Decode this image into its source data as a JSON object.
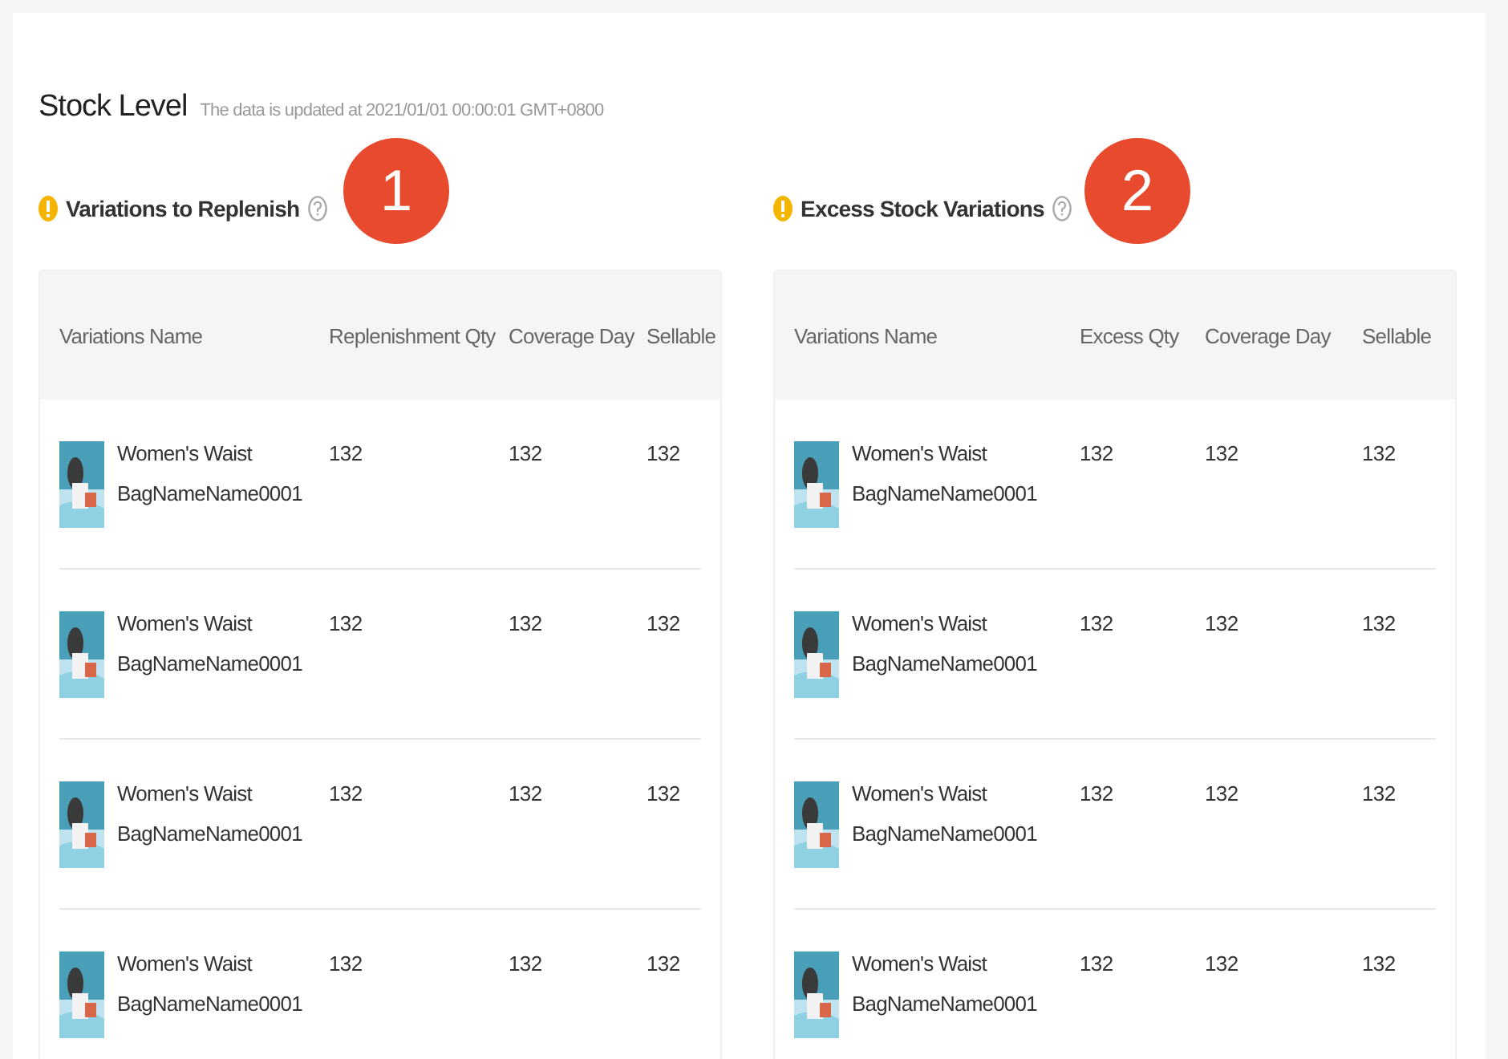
{
  "header": {
    "title": "Stock Level",
    "subtitle": "The data is updated at 2021/01/01 00:00:01 GMT+0800"
  },
  "sections": [
    {
      "marker": "1",
      "title": "Variations to Replenish",
      "columns": [
        "Variations Name",
        "Replenishment Qty",
        "Coverage Day",
        "Sellable"
      ],
      "rows": [
        {
          "name": "Women's Waist BagNameName0001",
          "values": [
            "132",
            "132",
            "132"
          ]
        },
        {
          "name": "Women's Waist BagNameName0001",
          "values": [
            "132",
            "132",
            "132"
          ]
        },
        {
          "name": "Women's Waist BagNameName0001",
          "values": [
            "132",
            "132",
            "132"
          ]
        },
        {
          "name": "Women's Waist BagNameName0001",
          "values": [
            "132",
            "132",
            "132"
          ]
        }
      ]
    },
    {
      "marker": "2",
      "title": "Excess Stock Variations",
      "columns": [
        "Variations Name",
        "Excess Qty",
        "Coverage Day",
        "Sellable"
      ],
      "rows": [
        {
          "name": "Women's Waist BagNameName0001",
          "values": [
            "132",
            "132",
            "132"
          ]
        },
        {
          "name": "Women's Waist BagNameName0001",
          "values": [
            "132",
            "132",
            "132"
          ]
        },
        {
          "name": "Women's Waist BagNameName0001",
          "values": [
            "132",
            "132",
            "132"
          ]
        },
        {
          "name": "Women's Waist BagNameName0001",
          "values": [
            "132",
            "132",
            "132"
          ]
        }
      ]
    }
  ]
}
